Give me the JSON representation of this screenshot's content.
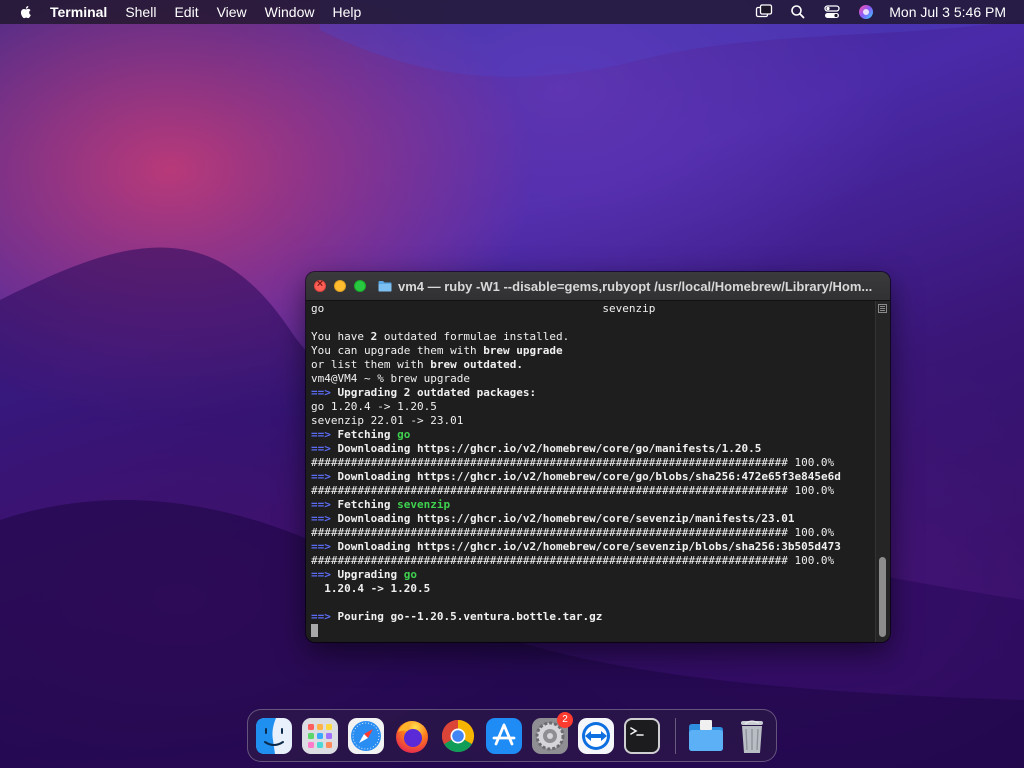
{
  "menubar": {
    "app_name": "Terminal",
    "items": [
      "Shell",
      "Edit",
      "View",
      "Window",
      "Help"
    ],
    "clock": "Mon Jul 3  5:46 PM"
  },
  "terminal": {
    "title": "vm4 — ruby -W1 --disable=gems,rubyopt /usr/local/Homebrew/Library/Hom...",
    "lines": {
      "l0_a": "go",
      "l0_b": "sevenzip",
      "l2_a": "You have ",
      "l2_b": "2",
      "l2_c": " outdated formulae installed.",
      "l3_a": "You can upgrade them with ",
      "l3_b": "brew upgrade",
      "l4_a": "or list them with ",
      "l4_b": "brew outdated",
      "l4_c": ".",
      "l5": "vm4@VM4 ~ % brew upgrade",
      "arrow": "==>",
      "l6": "Upgrading 2 outdated packages:",
      "l7": "go 1.20.4 -> 1.20.5",
      "l8": "sevenzip 22.01 -> 23.01",
      "l9_a": "Fetching ",
      "l9_b": "go",
      "l10": "Downloading https://ghcr.io/v2/homebrew/core/go/manifests/1.20.5",
      "progress": "######################################################################## 100.0%",
      "l12": "Downloading https://ghcr.io/v2/homebrew/core/go/blobs/sha256:472e65f3e845e6d",
      "l14_a": "Fetching ",
      "l14_b": "sevenzip",
      "l15": "Downloading https://ghcr.io/v2/homebrew/core/sevenzip/manifests/23.01",
      "l17": "Downloading https://ghcr.io/v2/homebrew/core/sevenzip/blobs/sha256:3b505d473",
      "l19_a": "Upgrading ",
      "l19_b": "go",
      "l20": "  1.20.4 -> 1.20.5",
      "l22": "Pouring go--1.20.5.ventura.bottle.tar.gz"
    }
  },
  "dock": {
    "apps": [
      "finder",
      "launchpad",
      "safari",
      "firefox",
      "chrome",
      "app-store",
      "system-settings",
      "teamviewer",
      "terminal",
      "downloads-folder",
      "trash"
    ],
    "settings_badge": "2"
  },
  "colors": {
    "prompt_arrow": "#5b6cf5",
    "highlight_green": "#3ed14f",
    "terminal_bg": "#1e1e1e"
  }
}
